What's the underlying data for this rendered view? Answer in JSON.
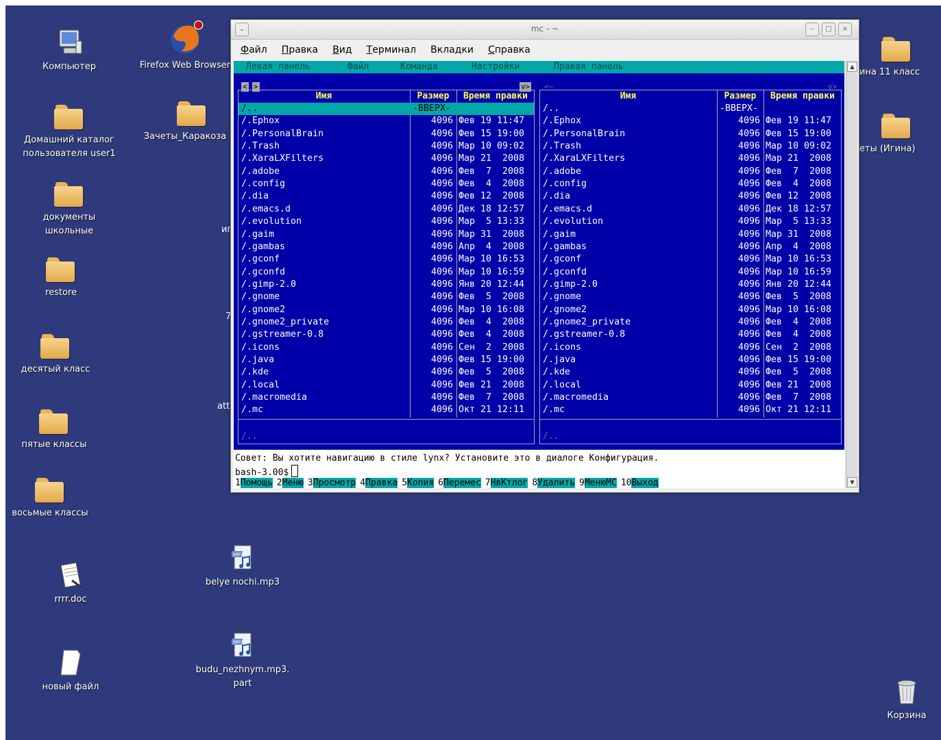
{
  "desktop": {
    "bg": "#2e3a7c",
    "icons": [
      {
        "label": "Компьютер",
        "icon": "computer-icon"
      },
      {
        "label": "Firefox Web Browser",
        "icon": "firefox-icon"
      },
      {
        "label": "Домашний каталог пользователя user1",
        "icon": "home-folder-icon"
      },
      {
        "label": "Зачеты_Каракоза",
        "icon": "folder-icon"
      },
      {
        "label": "документы школьные",
        "icon": "folder-icon"
      },
      {
        "label": "restore",
        "icon": "folder-icon"
      },
      {
        "label": "десятый класс",
        "icon": "folder-icon"
      },
      {
        "label": "пятые классы",
        "icon": "folder-icon"
      },
      {
        "label": "восьмые классы",
        "icon": "folder-icon"
      },
      {
        "label": "rrrr.doc",
        "icon": "document-icon"
      },
      {
        "label": "belye nochi.mp3",
        "icon": "audio-file-icon"
      },
      {
        "label": "budu_nezhnym.mp3.part",
        "icon": "audio-file-icon"
      },
      {
        "label": "новый файл",
        "icon": "blank-file-icon"
      },
      {
        "label": "ина 11 класс",
        "icon": "folder-icon"
      },
      {
        "label": "еты (Игина)",
        "icon": "folder-icon"
      },
      {
        "label": "Корзина",
        "icon": "trash-icon"
      }
    ],
    "partial_labels": [
      "иг",
      "7",
      "att"
    ]
  },
  "window": {
    "title": "mc - ~",
    "menu": [
      "Файл",
      "Правка",
      "Вид",
      "Терминал",
      "Вкладки",
      "Справка"
    ],
    "menu_underline": [
      "Ф",
      "П",
      "В",
      "Т",
      "",
      "С"
    ],
    "menu_rest": [
      "айл",
      "равка",
      "ид",
      "ерминал",
      "Вкладки",
      "правка"
    ]
  },
  "mc": {
    "topmenu": [
      "Левая панель",
      "Файл",
      "Команда",
      "Настройки",
      "Правая панель"
    ],
    "columns": {
      "name": "Имя",
      "size": "Размер",
      "time": "Время правки"
    },
    "up_row": {
      "name": "/..",
      "size": "-ВВЕРХ-"
    },
    "rows": [
      {
        "name": "/.Ephox",
        "size": "4096",
        "time": "Фев 19 11:47"
      },
      {
        "name": "/.PersonalBrain",
        "size": "4096",
        "time": "Фев 15 19:00"
      },
      {
        "name": "/.Trash",
        "size": "4096",
        "time": "Мар 10 09:02"
      },
      {
        "name": "/.XaraLXFilters",
        "size": "4096",
        "time": "Мар 21  2008"
      },
      {
        "name": "/.adobe",
        "size": "4096",
        "time": "Фев  7  2008"
      },
      {
        "name": "/.config",
        "size": "4096",
        "time": "Фев  4  2008"
      },
      {
        "name": "/.dia",
        "size": "4096",
        "time": "Фев 12  2008"
      },
      {
        "name": "/.emacs.d",
        "size": "4096",
        "time": "Дек 18 12:57"
      },
      {
        "name": "/.evolution",
        "size": "4096",
        "time": "Мар  5 13:33"
      },
      {
        "name": "/.gaim",
        "size": "4096",
        "time": "Мар 31  2008"
      },
      {
        "name": "/.gambas",
        "size": "4096",
        "time": "Апр  4  2008"
      },
      {
        "name": "/.gconf",
        "size": "4096",
        "time": "Мар 10 16:53"
      },
      {
        "name": "/.gconfd",
        "size": "4096",
        "time": "Мар 10 16:59"
      },
      {
        "name": "/.gimp-2.0",
        "size": "4096",
        "time": "Янв 20 12:44"
      },
      {
        "name": "/.gnome",
        "size": "4096",
        "time": "Фев  5  2008"
      },
      {
        "name": "/.gnome2",
        "size": "4096",
        "time": "Мар 10 16:08"
      },
      {
        "name": "/.gnome2_private",
        "size": "4096",
        "time": "Фев  4  2008"
      },
      {
        "name": "/.gstreamer-0.8",
        "size": "4096",
        "time": "Фев  4  2008"
      },
      {
        "name": "/.icons",
        "size": "4096",
        "time": "Сен  2  2008"
      },
      {
        "name": "/.java",
        "size": "4096",
        "time": "Фев 15 19:00"
      },
      {
        "name": "/.kde",
        "size": "4096",
        "time": "Фев  5  2008"
      },
      {
        "name": "/.local",
        "size": "4096",
        "time": "Фев 21  2008"
      },
      {
        "name": "/.macromedia",
        "size": "4096",
        "time": "Фев  7  2008"
      },
      {
        "name": "/.mc",
        "size": "4096",
        "time": "Окт 21 12:11"
      }
    ],
    "mini_status": "/..",
    "hint": "Совет: Вы хотите навигацию в стиле lynx? Установите это в диалоге Конфигурация.",
    "prompt": "bash-3.00$",
    "fkeys": [
      {
        "n": "1",
        "label": "Помощь"
      },
      {
        "n": "2",
        "label": "Меню"
      },
      {
        "n": "3",
        "label": "Просмотр"
      },
      {
        "n": "4",
        "label": "Правка"
      },
      {
        "n": "5",
        "label": "Копия"
      },
      {
        "n": "6",
        "label": "Перемес"
      },
      {
        "n": "7",
        "label": "НвКтлог"
      },
      {
        "n": "8",
        "label": "Удалить"
      },
      {
        "n": "9",
        "label": "МенюМС"
      },
      {
        "n": "10",
        "label": "Выход"
      }
    ]
  }
}
